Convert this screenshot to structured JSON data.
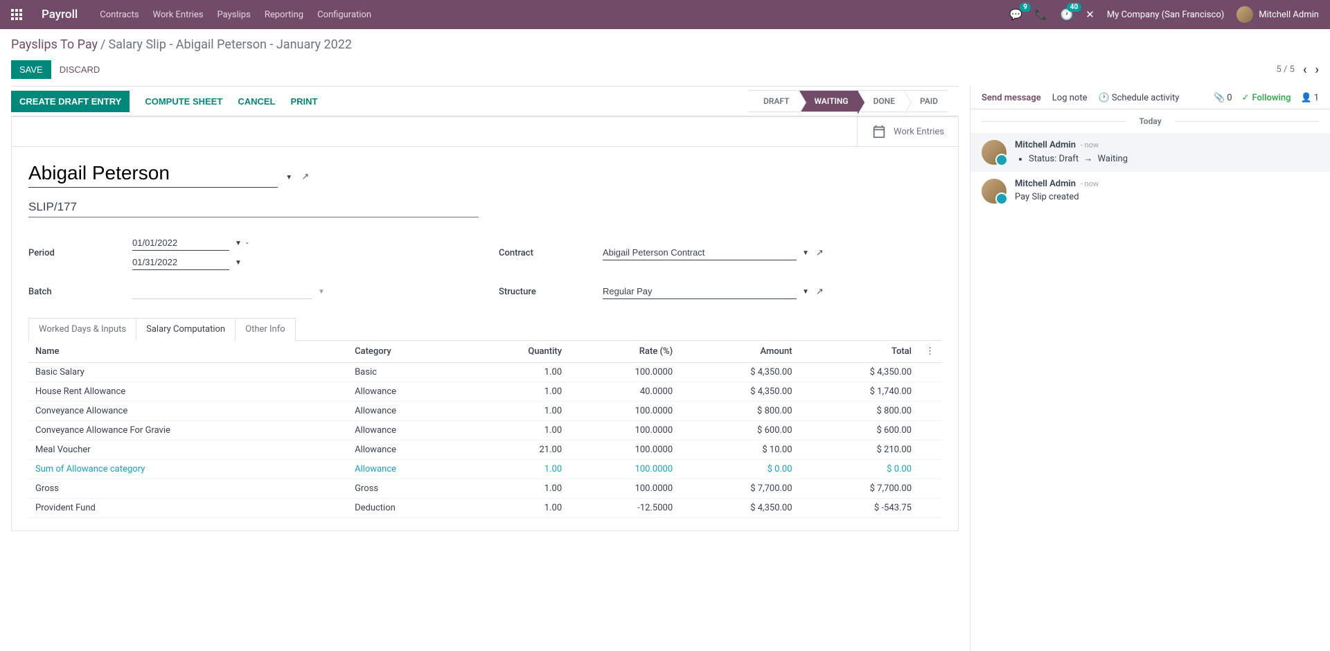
{
  "navbar": {
    "app": "Payroll",
    "items": [
      "Contracts",
      "Work Entries",
      "Payslips",
      "Reporting",
      "Configuration"
    ],
    "chat_badge": "9",
    "activity_badge": "40",
    "company": "My Company (San Francisco)",
    "user": "Mitchell Admin"
  },
  "breadcrumb": {
    "link": "Payslips To Pay",
    "current": "Salary Slip - Abigail Peterson - January 2022"
  },
  "actions": {
    "save": "SAVE",
    "discard": "DISCARD",
    "pager": "5 / 5"
  },
  "buttons": {
    "create_draft": "CREATE DRAFT ENTRY",
    "compute": "COMPUTE SHEET",
    "cancel": "CANCEL",
    "print": "PRINT"
  },
  "status": {
    "draft": "DRAFT",
    "waiting": "WAITING",
    "done": "DONE",
    "paid": "PAID"
  },
  "stat_button": {
    "work_entries": "Work Entries"
  },
  "form": {
    "employee": "Abigail Peterson",
    "slip": "SLIP/177",
    "labels": {
      "period": "Period",
      "batch": "Batch",
      "contract": "Contract",
      "structure": "Structure"
    },
    "period_from": "01/01/2022",
    "period_to": "01/31/2022",
    "batch": "",
    "contract": "Abigail Peterson Contract",
    "structure": "Regular Pay"
  },
  "tabs": {
    "worked": "Worked Days & Inputs",
    "salary": "Salary Computation",
    "other": "Other Info"
  },
  "table": {
    "headers": {
      "name": "Name",
      "category": "Category",
      "quantity": "Quantity",
      "rate": "Rate (%)",
      "amount": "Amount",
      "total": "Total"
    },
    "rows": [
      {
        "name": "Basic Salary",
        "category": "Basic",
        "quantity": "1.00",
        "rate": "100.0000",
        "amount": "$ 4,350.00",
        "total": "$ 4,350.00",
        "highlight": false
      },
      {
        "name": "House Rent Allowance",
        "category": "Allowance",
        "quantity": "1.00",
        "rate": "40.0000",
        "amount": "$ 4,350.00",
        "total": "$ 1,740.00",
        "highlight": false
      },
      {
        "name": "Conveyance Allowance",
        "category": "Allowance",
        "quantity": "1.00",
        "rate": "100.0000",
        "amount": "$ 800.00",
        "total": "$ 800.00",
        "highlight": false
      },
      {
        "name": "Conveyance Allowance For Gravie",
        "category": "Allowance",
        "quantity": "1.00",
        "rate": "100.0000",
        "amount": "$ 600.00",
        "total": "$ 600.00",
        "highlight": false
      },
      {
        "name": "Meal Voucher",
        "category": "Allowance",
        "quantity": "21.00",
        "rate": "100.0000",
        "amount": "$ 10.00",
        "total": "$ 210.00",
        "highlight": false
      },
      {
        "name": "Sum of Allowance category",
        "category": "Allowance",
        "quantity": "1.00",
        "rate": "100.0000",
        "amount": "$ 0.00",
        "total": "$ 0.00",
        "highlight": true
      },
      {
        "name": "Gross",
        "category": "Gross",
        "quantity": "1.00",
        "rate": "100.0000",
        "amount": "$ 7,700.00",
        "total": "$ 7,700.00",
        "highlight": false
      },
      {
        "name": "Provident Fund",
        "category": "Deduction",
        "quantity": "1.00",
        "rate": "-12.5000",
        "amount": "$ 4,350.00",
        "total": "$ -543.75",
        "highlight": false
      }
    ]
  },
  "chatter": {
    "send": "Send message",
    "log": "Log note",
    "schedule": "Schedule activity",
    "attach": "0",
    "following": "Following",
    "followers": "1",
    "today": "Today",
    "messages": [
      {
        "author": "Mitchell Admin",
        "time": "- now",
        "type": "status",
        "status_label": "Status:",
        "from": "Draft",
        "to": "Waiting"
      },
      {
        "author": "Mitchell Admin",
        "time": "- now",
        "type": "text",
        "body": "Pay Slip created"
      }
    ]
  }
}
